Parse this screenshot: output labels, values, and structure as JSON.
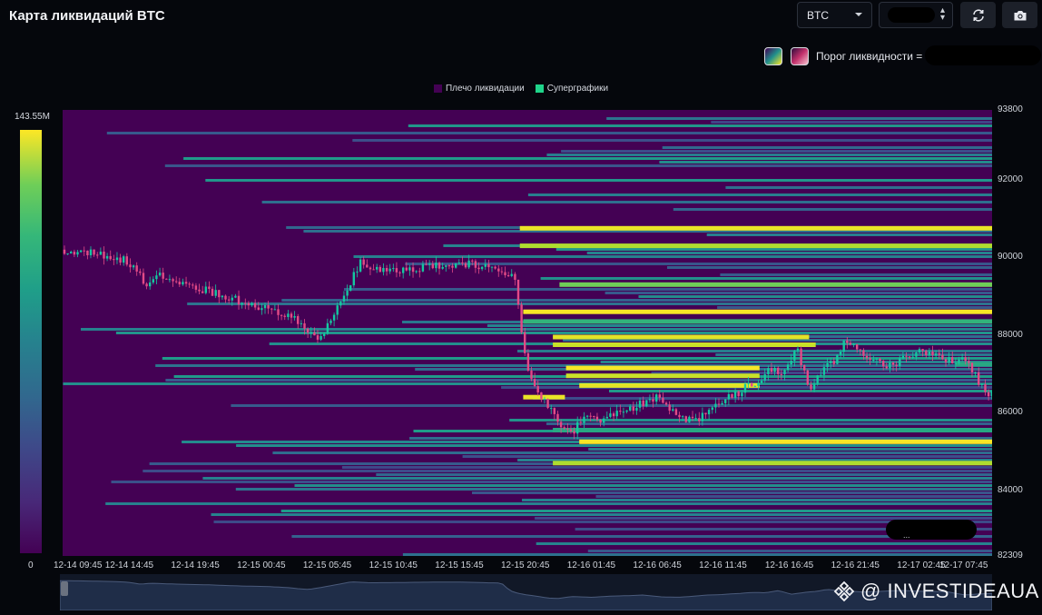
{
  "page": {
    "title": "Карта ликвидаций BTC"
  },
  "controls": {
    "coin_select": "BTC",
    "refresh_icon": "refresh-icon",
    "camera_icon": "camera-icon"
  },
  "threshold": {
    "label": "Порог ликвидности = 0"
  },
  "watermark": {
    "text": "@ INVESTIDEAUA",
    "logo_icon": "binance-logo-icon"
  },
  "chart_data": {
    "type": "heatmap",
    "legend": [
      {
        "name": "Плечо ликвидации",
        "color": "#440154"
      },
      {
        "name": "Суперграфики",
        "color": "#1fd48a"
      }
    ],
    "colorbar": {
      "max_label": "143.55M",
      "min_label": "0",
      "max": 143.55,
      "min": 0,
      "colormap": "viridis"
    },
    "x_ticks": [
      "12-14 09:45",
      "12-14 14:45",
      "12-14 19:45",
      "12-15 00:45",
      "12-15 05:45",
      "12-15 10:45",
      "12-15 15:45",
      "12-15 20:45",
      "12-16 01:45",
      "12-16 06:45",
      "12-16 11:45",
      "12-16 16:45",
      "12-16 21:45",
      "12-17 02:45",
      "12-17 07:45"
    ],
    "y_ticks": [
      "93800",
      "92000",
      "90000",
      "88000",
      "86000",
      "84000",
      "82309"
    ],
    "y_tick_values": [
      93800,
      92000,
      90000,
      88000,
      86000,
      84000,
      82309
    ],
    "ylim": [
      82309,
      93800
    ],
    "price_path": [
      [
        0,
        90200
      ],
      [
        0.3,
        90150
      ],
      [
        0.6,
        90050
      ],
      [
        0.9,
        89950
      ],
      [
        1.1,
        89700
      ],
      [
        1.25,
        89250
      ],
      [
        1.4,
        89550
      ],
      [
        1.7,
        89350
      ],
      [
        2.0,
        89200
      ],
      [
        2.3,
        89100
      ],
      [
        2.6,
        88900
      ],
      [
        2.9,
        88750
      ],
      [
        3.2,
        88650
      ],
      [
        3.5,
        88400
      ],
      [
        3.7,
        88050
      ],
      [
        3.85,
        87900
      ],
      [
        4.1,
        88600
      ],
      [
        4.35,
        89400
      ],
      [
        4.5,
        89900
      ],
      [
        4.8,
        89650
      ],
      [
        5.2,
        89700
      ],
      [
        5.6,
        89800
      ],
      [
        6.0,
        89850
      ],
      [
        6.3,
        89800
      ],
      [
        6.6,
        89650
      ],
      [
        6.82,
        89600
      ],
      [
        6.9,
        88300
      ],
      [
        7.0,
        87200
      ],
      [
        7.15,
        86600
      ],
      [
        7.4,
        86000
      ],
      [
        7.55,
        85600
      ],
      [
        7.7,
        85500
      ],
      [
        7.9,
        86000
      ],
      [
        8.2,
        85800
      ],
      [
        8.5,
        86100
      ],
      [
        8.8,
        86250
      ],
      [
        9.0,
        86400
      ],
      [
        9.3,
        85900
      ],
      [
        9.55,
        85800
      ],
      [
        9.8,
        86100
      ],
      [
        10.0,
        86400
      ],
      [
        10.2,
        86500
      ],
      [
        10.35,
        86700
      ],
      [
        10.5,
        86800
      ],
      [
        10.7,
        87100
      ],
      [
        10.9,
        87000
      ],
      [
        11.1,
        87600
      ],
      [
        11.3,
        86600
      ],
      [
        11.5,
        87100
      ],
      [
        11.7,
        87400
      ],
      [
        11.85,
        87900
      ],
      [
        12.0,
        87600
      ],
      [
        12.2,
        87400
      ],
      [
        12.4,
        87200
      ],
      [
        12.6,
        87300
      ],
      [
        12.8,
        87500
      ],
      [
        13.0,
        87600
      ],
      [
        13.3,
        87400
      ],
      [
        13.5,
        87350
      ],
      [
        13.7,
        87300
      ],
      [
        13.85,
        86800
      ],
      [
        14.0,
        86400
      ],
      [
        14.2,
        86700
      ],
      [
        14.4,
        86800
      ]
    ]
  }
}
